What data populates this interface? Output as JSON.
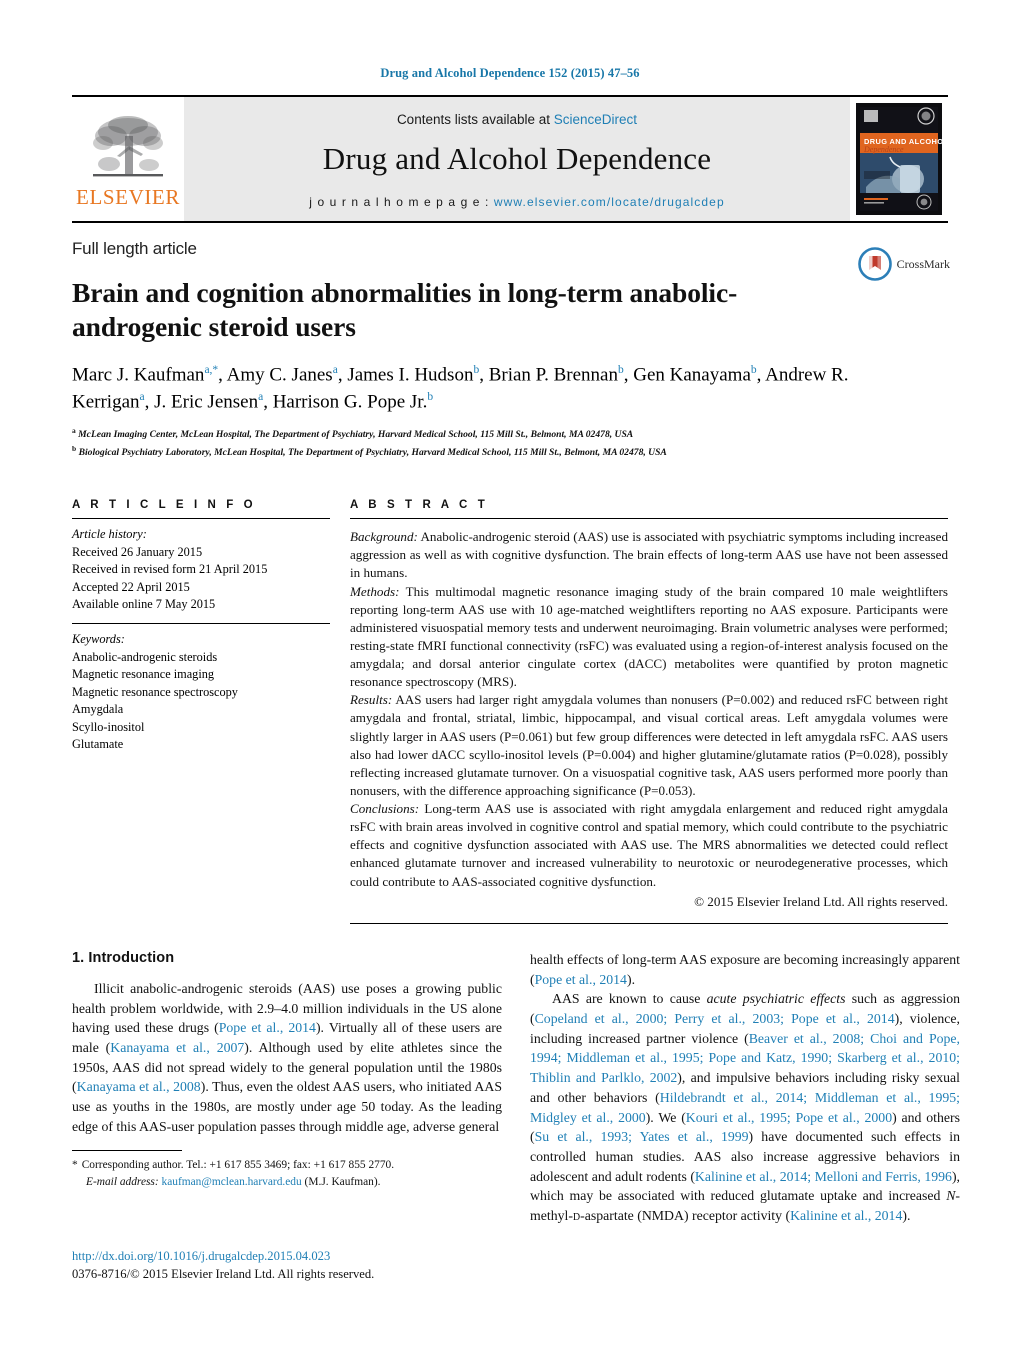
{
  "running_head": "Drug and Alcohol Dependence 152 (2015) 47–56",
  "masthead": {
    "contents_prefix": "Contents lists available at ",
    "contents_link": "ScienceDirect",
    "journal_name": "Drug and Alcohol Dependence",
    "homepage_prefix": "j o u r n a l   h o m e p a g e :  ",
    "homepage_url": "www.elsevier.com/locate/drugalcdep",
    "publisher_wordmark": "ELSEVIER",
    "cover": {
      "line1": "DRUG AND ALCOHOL",
      "line2": "Dependence"
    }
  },
  "article": {
    "kind": "Full length article",
    "title": "Brain and cognition abnormalities in long-term anabolic-androgenic steroid users",
    "crossmark_label": "CrossMark",
    "authors_html": "Marc J. Kaufman<sup>a,*</sup>, Amy C. Janes<sup>a</sup>, James I. Hudson<sup>b</sup>, Brian P. Brennan<sup>b</sup>, Gen Kanayama<sup>b</sup>, Andrew R. Kerrigan<sup>a</sup>, J. Eric Jensen<sup>a</sup>, Harrison G. Pope Jr.<sup>b</sup>",
    "affiliations": [
      {
        "mark": "a",
        "text": "McLean Imaging Center, McLean Hospital, The Department of Psychiatry, Harvard Medical School, 115 Mill St., Belmont, MA 02478, USA"
      },
      {
        "mark": "b",
        "text": "Biological Psychiatry Laboratory, McLean Hospital, The Department of Psychiatry, Harvard Medical School, 115 Mill St., Belmont, MA 02478, USA"
      }
    ]
  },
  "info": {
    "heading": "A R T I C L E  I N F O",
    "history_label": "Article history:",
    "history": [
      "Received 26 January 2015",
      "Received in revised form 21 April 2015",
      "Accepted 22 April 2015",
      "Available online 7 May 2015"
    ],
    "keywords_label": "Keywords:",
    "keywords": [
      "Anabolic-androgenic steroids",
      "Magnetic resonance imaging",
      "Magnetic resonance spectroscopy",
      "Amygdala",
      "Scyllo-inositol",
      "Glutamate"
    ]
  },
  "abstract": {
    "heading": "A B S T R A C T",
    "sections": [
      {
        "label": "Background:",
        "text": " Anabolic-androgenic steroid (AAS) use is associated with psychiatric symptoms including increased aggression as well as with cognitive dysfunction. The brain effects of long-term AAS use have not been assessed in humans."
      },
      {
        "label": "Methods:",
        "text": " This multimodal magnetic resonance imaging study of the brain compared 10 male weightlifters reporting long-term AAS use with 10 age-matched weightlifters reporting no AAS exposure. Participants were administered visuospatial memory tests and underwent neuroimaging. Brain volumetric analyses were performed; resting-state fMRI functional connectivity (rsFC) was evaluated using a region-of-interest analysis focused on the amygdala; and dorsal anterior cingulate cortex (dACC) metabolites were quantified by proton magnetic resonance spectroscopy (MRS)."
      },
      {
        "label": "Results:",
        "text": " AAS users had larger right amygdala volumes than nonusers (P=0.002) and reduced rsFC between right amygdala and frontal, striatal, limbic, hippocampal, and visual cortical areas. Left amygdala volumes were slightly larger in AAS users (P=0.061) but few group differences were detected in left amygdala rsFC. AAS users also had lower dACC scyllo-inositol levels (P=0.004) and higher glutamine/glutamate ratios (P=0.028), possibly reflecting increased glutamate turnover. On a visuospatial cognitive task, AAS users performed more poorly than nonusers, with the difference approaching significance (P=0.053)."
      },
      {
        "label": "Conclusions:",
        "text": " Long-term AAS use is associated with right amygdala enlargement and reduced right amygdala rsFC with brain areas involved in cognitive control and spatial memory, which could contribute to the psychiatric effects and cognitive dysfunction associated with AAS use. The MRS abnormalities we detected could reflect enhanced glutamate turnover and increased vulnerability to neurotoxic or neurodegenerative processes, which could contribute to AAS-associated cognitive dysfunction."
      }
    ],
    "copyright": "© 2015 Elsevier Ireland Ltd. All rights reserved."
  },
  "introduction": {
    "heading": "1.  Introduction",
    "left_paragraph_html": "Illicit anabolic-androgenic steroids (AAS) use poses a growing public health problem worldwide, with 2.9–4.0 million individuals in the US alone having used these drugs (<span class=\"ref\">Pope et al., 2014</span>). Virtually all of these users are male (<span class=\"ref\">Kanayama et al., 2007</span>). Although used by elite athletes since the 1950s, AAS did not spread widely to the general population until the 1980s (<span class=\"ref\">Kanayama et al., 2008</span>). Thus, even the oldest AAS users, who initiated AAS use as youths in the 1980s, are mostly under age 50 today. As the leading edge of this AAS-user population passes through middle age, adverse general",
    "right_paragraph1_html": "health effects of long-term AAS exposure are becoming increasingly apparent (<span class=\"ref\">Pope et al., 2014</span>).",
    "right_paragraph2_html": "AAS are known to cause <span class=\"ital\">acute psychiatric effects</span> such as aggression (<span class=\"ref\">Copeland et al., 2000; Perry et al., 2003; Pope et al., 2014</span>), violence, including increased partner violence (<span class=\"ref\">Beaver et al., 2008; Choi and Pope, 1994; Middleman et al., 1995; Pope and Katz, 1990; Skarberg et al., 2010; Thiblin and Parlklo, 2002</span>), and impulsive behaviors including risky sexual and other behaviors (<span class=\"ref\">Hildebrandt et al., 2014; Middleman et al., 1995; Midgley et al., 2000</span>). We (<span class=\"ref\">Kouri et al., 1995; Pope et al., 2000</span>) and others (<span class=\"ref\">Su et al., 1993; Yates et al., 1999</span>) have documented such effects in controlled human studies. AAS also increase aggressive behaviors in adolescent and adult rodents (<span class=\"ref\">Kalinine et al., 2014; Melloni and Ferris, 1996</span>), which may be associated with reduced glutamate uptake and increased <span class=\"ital\">N</span>-methyl-<span class=\"sc\">d</span>-aspartate (NMDA) receptor activity (<span class=\"ref\">Kalinine et al., 2014</span>)."
  },
  "footnote": {
    "star": "*",
    "corresponding": "Corresponding author. Tel.: +1 617 855 3469; fax: +1 617 855 2770.",
    "email_label": "E-mail address:",
    "email": "kaufman@mclean.harvard.edu",
    "email_suffix": "(M.J. Kaufman)."
  },
  "doi": {
    "url": "http://dx.doi.org/10.1016/j.drugalcdep.2015.04.023",
    "issn_line": "0376-8716/© 2015 Elsevier Ireland Ltd. All rights reserved."
  },
  "colors": {
    "link": "#1f7fb5",
    "elsevier_orange": "#e87722",
    "masthead_bg": "#e9e9e9"
  }
}
